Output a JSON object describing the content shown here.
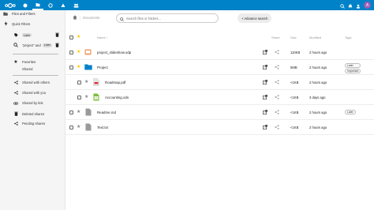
{
  "topbar": {
    "accent": "#0082c9",
    "logo_icon": "nextcloud-logo",
    "apps": [
      "dashboard-icon",
      "files-icon",
      "photos-icon",
      "activity-icon",
      "contacts-icon"
    ],
    "user_initial": "A"
  },
  "sidebar": {
    "files_filters": "Files and Filters",
    "quick_filters": "Quick Filters",
    "filters": [
      {
        "icon": "tag-icon",
        "label": "Later"
      },
      {
        "icon": "search-icon",
        "label_prefix": "\"project\" and",
        "label_pill": "Later"
      }
    ],
    "favorites": "Favorites",
    "favorite_item": "Shared",
    "shares": [
      {
        "icon": "share-icon",
        "label": "Shared with others"
      },
      {
        "icon": "share-icon",
        "label": "Shared with you"
      },
      {
        "icon": "link-icon",
        "label": "Shared by link"
      },
      {
        "icon": "trash-icon",
        "label": "Deleted shares"
      },
      {
        "icon": "share-icon",
        "label": "Pending shares"
      }
    ]
  },
  "main": {
    "breadcrumb": "Documents",
    "search_placeholder": "Search files or folders...",
    "advanced_search": "+ Advance search",
    "columns": {
      "name": "Name ↑",
      "share": "Share",
      "size": "Size",
      "modified": "Modified",
      "tags": "Tags"
    },
    "files": [
      {
        "name": "project_slideshow.odp",
        "icon": "presentation-icon",
        "starred": true,
        "indent": 0,
        "size": "110KB",
        "modified": "2 hours ago",
        "tags": []
      },
      {
        "name": "Project",
        "icon": "folder-icon",
        "starred": true,
        "indent": 0,
        "size": "5MB",
        "modified": "2 hours ago",
        "tags": [
          "Later",
          "Important"
        ]
      },
      {
        "name": "Roadmap.pdf",
        "icon": "pdf-icon",
        "starred": false,
        "indent": 1,
        "size": "<1KB",
        "modified": "2 hours ago",
        "tags": []
      },
      {
        "name": "Accounting.ods",
        "icon": "spreadsheet-icon",
        "starred": false,
        "indent": 1,
        "size": "<1KB",
        "modified": "3 days ago",
        "tags": []
      },
      {
        "name": "Readme.md",
        "icon": "text-file-icon",
        "starred": false,
        "indent": 0,
        "size": "<1KB",
        "modified": "2 hours ago",
        "tags": [
          "Later"
        ]
      },
      {
        "name": "Text.txt",
        "icon": "text-file-icon",
        "starred": false,
        "indent": 0,
        "size": "<1KB",
        "modified": "2 hours ago",
        "tags": []
      }
    ]
  }
}
